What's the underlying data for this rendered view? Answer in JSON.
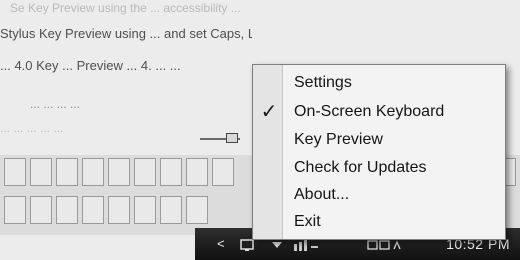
{
  "background": {
    "doc_lines": [
      "Se Key Preview using the ... accessibility ...",
      "Stylus Key Preview using ... and set Caps, Liquor",
      "... 4.0 Key ... Preview ... 4. ... ...",
      "... ... ... ...",
      "... ... ... ... ..."
    ]
  },
  "context_menu": {
    "items": [
      {
        "label": "Settings",
        "checked": false
      },
      {
        "label": "On-Screen Keyboard",
        "checked": true
      },
      {
        "label": "Key Preview",
        "checked": false
      },
      {
        "label": "Check for Updates",
        "checked": false
      },
      {
        "label": "About...",
        "checked": false
      },
      {
        "label": "Exit",
        "checked": false
      }
    ],
    "check_glyph": "✓"
  },
  "taskbar": {
    "chevron": "<",
    "clock": "10:52 PM"
  },
  "colors": {
    "menu_bg": "#f3f3f3",
    "taskbar_bg": "#1a1a1a"
  }
}
